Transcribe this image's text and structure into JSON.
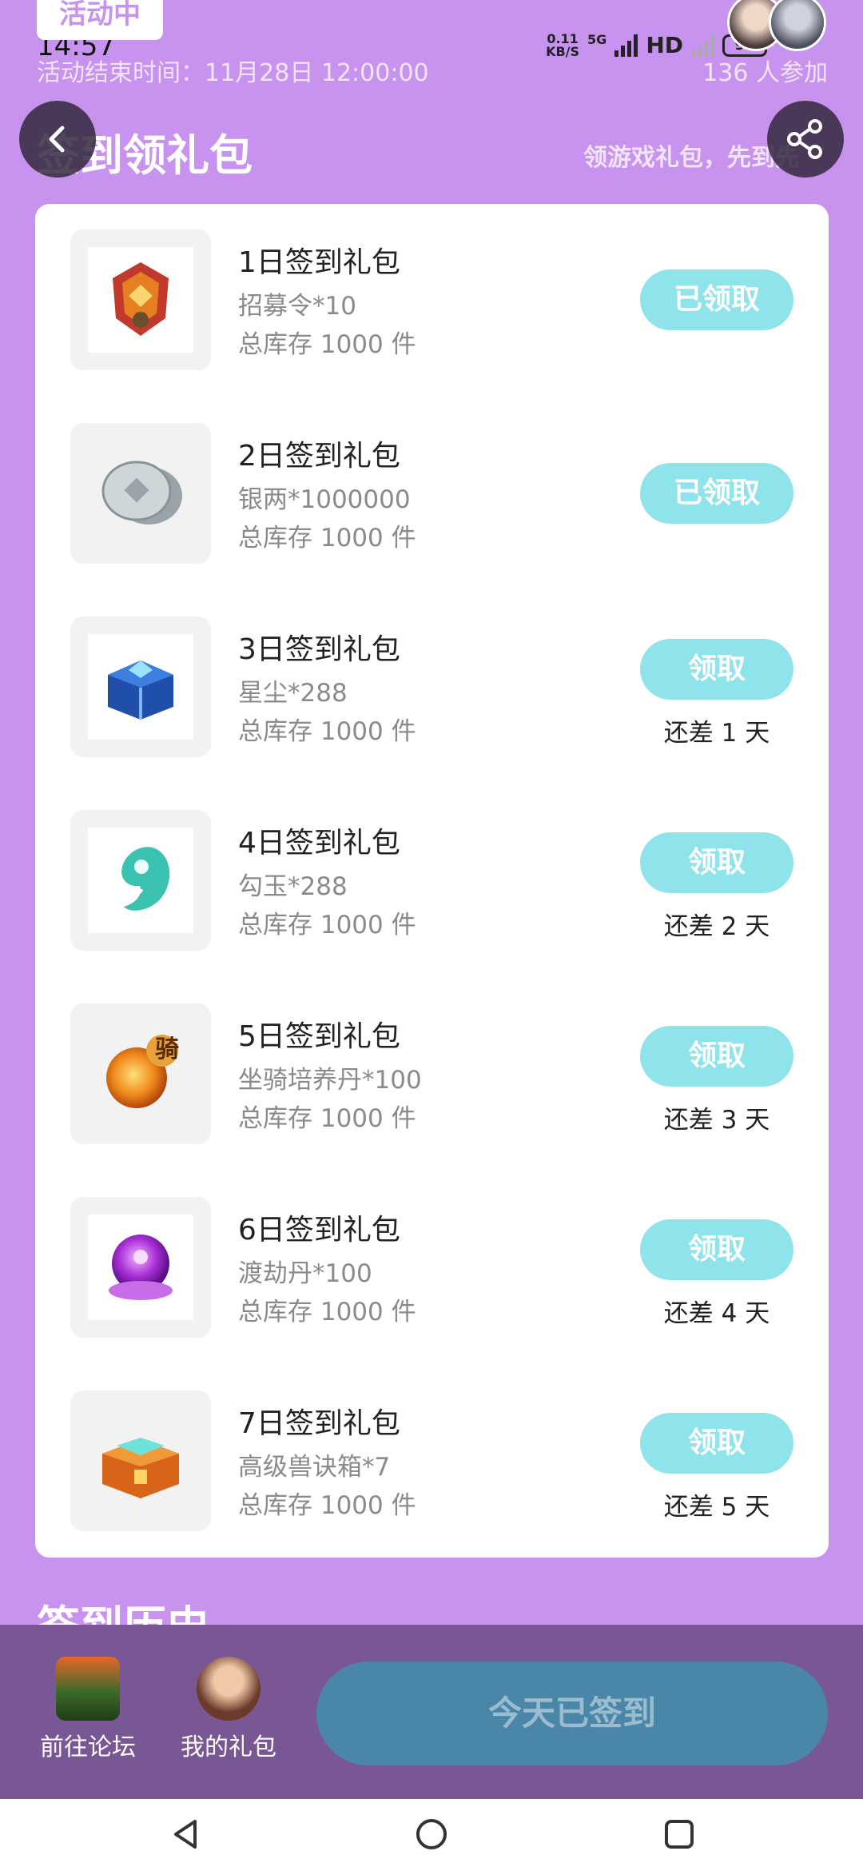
{
  "status_bar": {
    "time": "14:57",
    "net_speed": "0.11\nKB/S",
    "network": "5G",
    "hd": "HD",
    "battery": "91"
  },
  "header": {
    "activity_badge": "活动中",
    "end_time": "活动结束时间：11月28日 12:00:00",
    "participants": "136 人参加",
    "title": "签到领礼包",
    "subtitle": "领游戏礼包，先到先"
  },
  "gifts": [
    {
      "title": "1日签到礼包",
      "item": "招募令*10",
      "stock": "总库存 1000 件",
      "button": "已领取",
      "claimed": true,
      "days_left": ""
    },
    {
      "title": "2日签到礼包",
      "item": "银两*1000000",
      "stock": "总库存 1000 件",
      "button": "已领取",
      "claimed": true,
      "days_left": ""
    },
    {
      "title": "3日签到礼包",
      "item": "星尘*288",
      "stock": "总库存 1000 件",
      "button": "领取",
      "claimed": false,
      "days_left": "还差 1 天"
    },
    {
      "title": "4日签到礼包",
      "item": "勾玉*288",
      "stock": "总库存 1000 件",
      "button": "领取",
      "claimed": false,
      "days_left": "还差 2 天"
    },
    {
      "title": "5日签到礼包",
      "item": "坐骑培养丹*100",
      "stock": "总库存 1000 件",
      "button": "领取",
      "claimed": false,
      "days_left": "还差 3 天"
    },
    {
      "title": "6日签到礼包",
      "item": "渡劫丹*100",
      "stock": "总库存 1000 件",
      "button": "领取",
      "claimed": false,
      "days_left": "还差 4 天"
    },
    {
      "title": "7日签到礼包",
      "item": "高级兽诀箱*7",
      "stock": "总库存 1000 件",
      "button": "领取",
      "claimed": false,
      "days_left": "还差 5 天"
    }
  ],
  "icons": [
    "recruit-token-icon",
    "silver-coin-icon",
    "stardust-chest-icon",
    "magatama-icon",
    "mount-pill-icon",
    "tribulation-pill-icon",
    "beast-chest-icon"
  ],
  "thumb_badge": "骑",
  "history_heading": "签到历史",
  "bottom_bar": {
    "forum_label": "前往论坛",
    "my_gifts_label": "我的礼包",
    "signed_label": "今天已签到"
  },
  "colors": {
    "background": "#c893ef",
    "claim_button": "#8fe3ea",
    "bottom_bar": "#795694",
    "signed_button": "#4a86a8"
  }
}
